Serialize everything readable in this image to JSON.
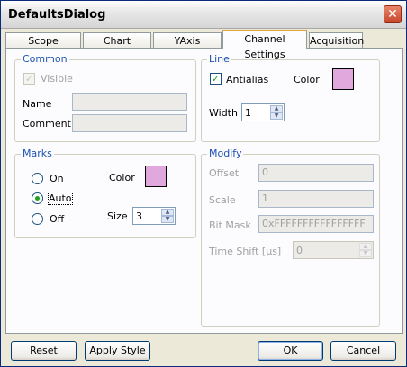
{
  "window": {
    "title": "DefaultsDialog",
    "close_glyph": "✕"
  },
  "tabs": [
    {
      "label": "Scope Settings"
    },
    {
      "label": "Chart Settings"
    },
    {
      "label": "YAxis Settings"
    },
    {
      "label": "Channel Settings",
      "active": true
    },
    {
      "label": "Acquisition"
    }
  ],
  "common": {
    "legend": "Common",
    "visible_label": "Visible",
    "visible_checked": true,
    "name_label": "Name",
    "name_value": "",
    "comment_label": "Comment:",
    "comment_value": ""
  },
  "line": {
    "legend": "Line",
    "antialias_label": "Antialias",
    "antialias_checked": true,
    "color_label": "Color",
    "color": "#e0a8dc",
    "width_label": "Width",
    "width_value": "1"
  },
  "marks": {
    "legend": "Marks",
    "options": [
      {
        "label": "On",
        "selected": false
      },
      {
        "label": "Auto",
        "selected": true
      },
      {
        "label": "Off",
        "selected": false
      }
    ],
    "color_label": "Color",
    "color": "#e0a8dc",
    "size_label": "Size",
    "size_value": "3"
  },
  "modify": {
    "legend": "Modify",
    "offset_label": "Offset",
    "offset_value": "0",
    "scale_label": "Scale",
    "scale_value": "1",
    "bitmask_label": "Bit Mask",
    "bitmask_value": "0xFFFFFFFFFFFFFFFF",
    "timeshift_label": "Time Shift [µs]",
    "timeshift_value": "0"
  },
  "buttons": {
    "reset": "Reset",
    "apply_style": "Apply Style",
    "ok": "OK",
    "cancel": "Cancel"
  },
  "icons": {
    "check": "✓",
    "spin_up": "▲",
    "spin_down": "▼"
  }
}
